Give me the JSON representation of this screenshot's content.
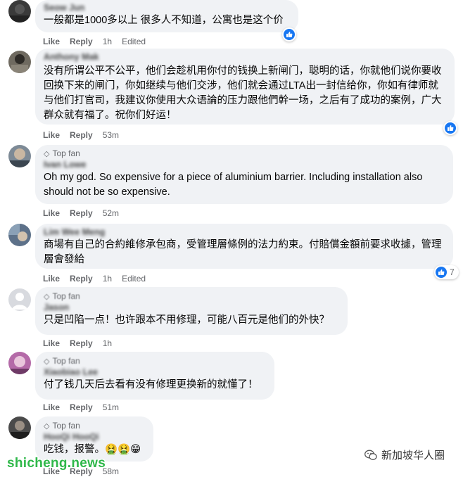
{
  "comments": [
    {
      "author": "Seow Jun",
      "text": "一般都是1000多以上 很多人不知道，公寓也是这个价",
      "time": "1h",
      "edited": "Edited"
    },
    {
      "author": "Anthony Mak",
      "text": "没有所谓公平不公平，他们会趁机用你付的钱换上新闸门，聪明的话，你就他们说你要收回换下来的闸门，你如继续与他们交涉，他们就会通过LTA出一封信给你，你如有律师就与他们打官司，我建议你使用大众语論的压力跟他們幹一场，之后有了成功的案例，广大群众就有福了。祝你们好运！",
      "time": "53m"
    },
    {
      "badge": "Top fan",
      "author": "Ivan Lowe",
      "text": "Oh my god. So expensive for a piece of aluminium barrier. Including installation also should not be so expensive.",
      "time": "52m"
    },
    {
      "author": "Lim Wee Meng",
      "text": "商場有自己的合約維修承包商，受管理層條例的法力約束。付賠償金額前要求收據，管理層會發給",
      "time": "1h",
      "edited": "Edited",
      "reaction_count": "7"
    },
    {
      "badge": "Top fan",
      "author": "Jason",
      "text": "只是凹陷一点！也许跟本不用修理，可能八百元是他们的外快？",
      "time": "1h"
    },
    {
      "badge": "Top fan",
      "author": "Xiaobiao Lee",
      "text": "付了钱几天后去看有没有修理更换新的就懂了！",
      "time": "51m"
    },
    {
      "badge": "Top fan",
      "author": "HooQi HooQi",
      "text": "吃钱，报警。🤮🤮😁",
      "time": "58m"
    }
  ],
  "actions": {
    "like": "Like",
    "reply": "Reply"
  },
  "watermark": "shicheng.news",
  "brand": "新加坡华人圈",
  "colors": {
    "bubble": "#f0f2f5",
    "like_blue": "#1877f2",
    "meta": "#65676b",
    "watermark": "#2fb84a"
  }
}
